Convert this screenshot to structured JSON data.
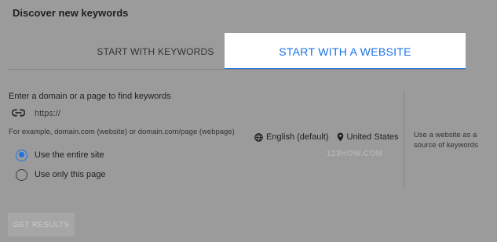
{
  "dialog": {
    "title": "Discover new keywords"
  },
  "tabs": [
    {
      "label": "START WITH KEYWORDS",
      "active": false
    },
    {
      "label": "START WITH A WEBSITE",
      "active": true
    }
  ],
  "form": {
    "domain_label": "Enter a domain or a page to find keywords",
    "url_placeholder": "https://",
    "url_icon": "link-icon",
    "hint": "For example, domain.com (website) or domain.com/page (webpage)",
    "language": {
      "label": "English (default)",
      "icon": "globe-icon"
    },
    "location": {
      "label": "United States",
      "icon": "location-pin-icon"
    },
    "scope_options": [
      {
        "label": "Use the entire site",
        "selected": true
      },
      {
        "label": "Use only this page",
        "selected": false
      }
    ]
  },
  "side_note": "Use a website as a source of keywords",
  "watermark": "123HOW.COM",
  "actions": {
    "get_results_label": "GET RESULTS",
    "enabled": false
  },
  "colors": {
    "accent": "#1a73e8",
    "overlay_gray": "#9b9b9b",
    "active_tab_bg": "#ffffff"
  }
}
